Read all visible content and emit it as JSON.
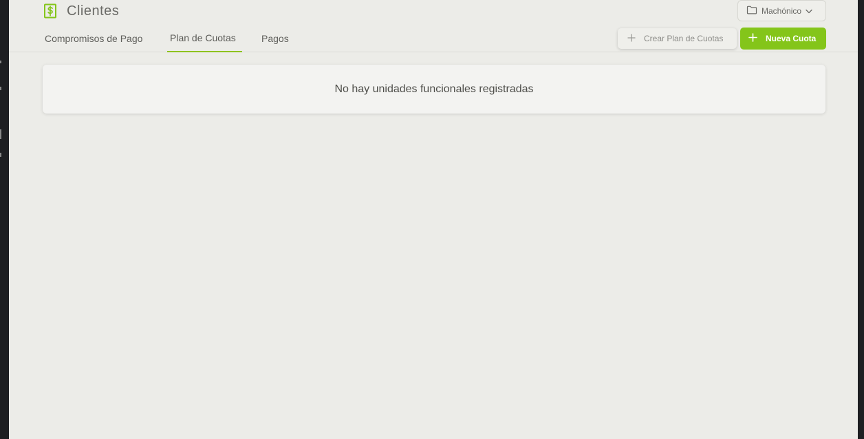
{
  "header": {
    "title": "Clientes",
    "brand_icon": "dollar-receipt-icon",
    "project_select": {
      "value": "Machónico",
      "icon": "folder-icon",
      "chevron": "chevron-down-icon"
    }
  },
  "tabs": [
    {
      "label": "Compromisos de Pago",
      "active": false
    },
    {
      "label": "Plan de Cuotas",
      "active": true
    },
    {
      "label": "Pagos",
      "active": false
    }
  ],
  "actions": {
    "create_plan_label": "Crear Plan de Cuotas",
    "new_quota_label": "Nueva Cuota"
  },
  "main": {
    "empty_message": "No hay unidades funcionales registradas"
  },
  "colors": {
    "accent": "#84c51a",
    "background": "#ecece8",
    "card": "#f3f3f1"
  }
}
